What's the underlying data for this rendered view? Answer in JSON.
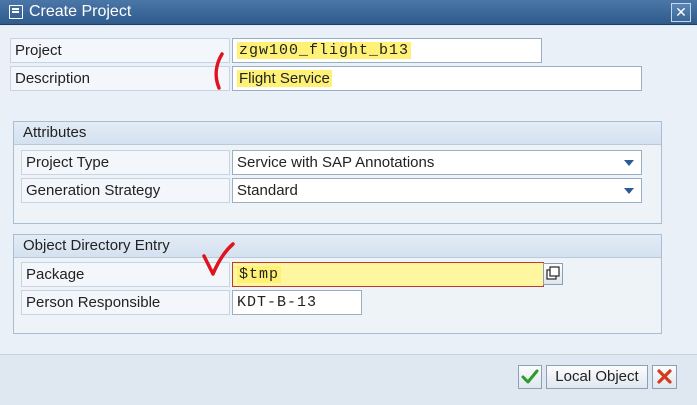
{
  "window": {
    "title": "Create Project",
    "close_icon": "close-x"
  },
  "form": {
    "project": {
      "label": "Project",
      "value": "zgw100_flight_b13"
    },
    "description": {
      "label": "Description",
      "value": "Flight Service"
    }
  },
  "attributes": {
    "title": "Attributes",
    "project_type": {
      "label": "Project Type",
      "value": "Service with SAP Annotations"
    },
    "generation_strategy": {
      "label": "Generation Strategy",
      "value": "Standard"
    }
  },
  "object_directory": {
    "title": "Object Directory Entry",
    "package": {
      "label": "Package",
      "value": "$tmp"
    },
    "person_responsible": {
      "label": "Person Responsible",
      "value": "KDT-B-13"
    }
  },
  "buttons": {
    "confirm_icon": "checkmark-icon",
    "local_object": "Local Object",
    "cancel_icon": "cancel-x-icon"
  },
  "colors": {
    "highlight": "#fff176",
    "annotation_red": "#e0141e",
    "titlebar": "#3a6597",
    "confirm_green": "#2e9a2e",
    "cancel_red": "#d63a1c"
  }
}
